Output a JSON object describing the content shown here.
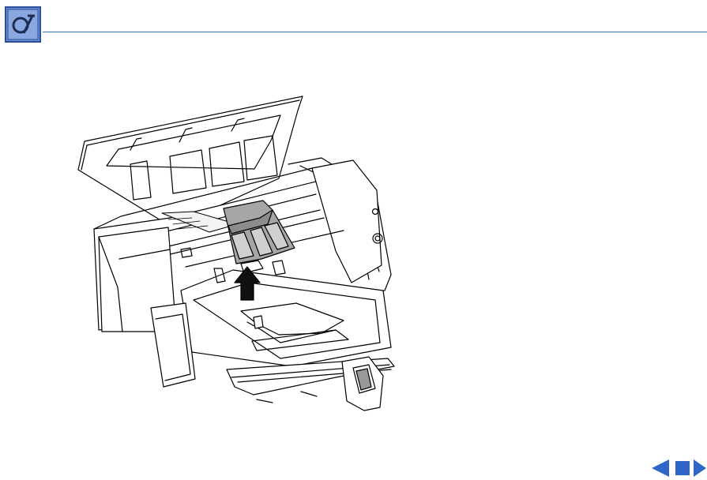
{
  "header": {
    "icon": "apple-service-manual-icon",
    "accent_color": "#3a73b8"
  },
  "illustration": {
    "subject": "printer-with-open-cover-cartridge-removal",
    "arrow_icon": "up-arrow-icon"
  },
  "nav": {
    "prev_icon": "previous-page-icon",
    "home_icon": "stop-icon",
    "next_icon": "next-page-icon",
    "color": "#2f66c8"
  }
}
